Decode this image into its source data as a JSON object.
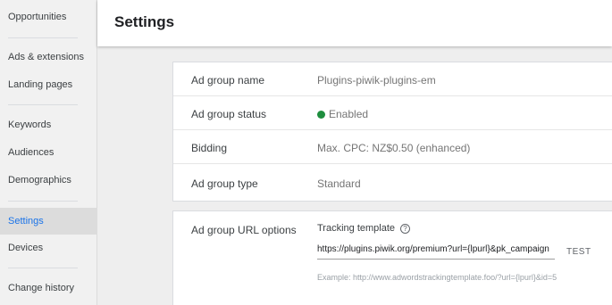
{
  "sidebar": {
    "items": [
      {
        "label": "Opportunities"
      },
      {
        "label": "Ads & extensions"
      },
      {
        "label": "Landing pages"
      },
      {
        "label": "Keywords"
      },
      {
        "label": "Audiences"
      },
      {
        "label": "Demographics"
      },
      {
        "label": "Settings",
        "active": true
      },
      {
        "label": "Devices"
      },
      {
        "label": "Change history"
      }
    ]
  },
  "header": {
    "title": "Settings"
  },
  "general": {
    "rows": [
      {
        "label": "Ad group name",
        "value": "Plugins-piwik-plugins-em"
      },
      {
        "label": "Ad group status",
        "value": "Enabled",
        "status_color": "#1e8e3e"
      },
      {
        "label": "Bidding",
        "value": "Max. CPC: NZ$0.50 (enhanced)"
      },
      {
        "label": "Ad group type",
        "value": "Standard"
      }
    ]
  },
  "url_options": {
    "label": "Ad group URL options",
    "tracking_template_label": "Tracking template",
    "help_icon": "?",
    "tracking_template_value": "https://plugins.piwik.org/premium?url={lpurl}&pk_campaign",
    "test_label": "TEST",
    "example": "Example: http://www.adwordstrackingtemplate.foo/?url={lpurl}&id=5"
  },
  "colors": {
    "accent": "#1a73e8",
    "enabled": "#1e8e3e"
  }
}
